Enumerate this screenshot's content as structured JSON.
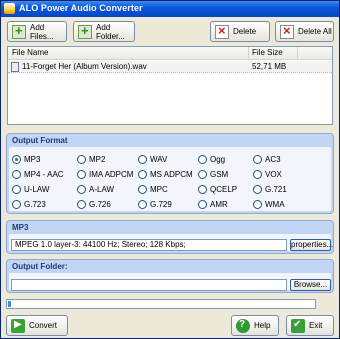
{
  "window": {
    "title": "ALO Power Audio Converter"
  },
  "toolbar": {
    "add_files": "Add Files...",
    "add_folder": "Add Folder...",
    "delete": "Delete",
    "delete_all": "Delete All"
  },
  "filelist": {
    "columns": [
      "File Name",
      "File Size"
    ],
    "rows": [
      {
        "name": "11-Forget Her (Album Version).wav",
        "size": "52,71 MB"
      }
    ]
  },
  "output_format": {
    "title": "Output Format",
    "selected": "MP3",
    "options": [
      "MP3",
      "MP2",
      "WAV",
      "Ogg",
      "AC3",
      "MP4 - AAC",
      "IMA ADPCM",
      "MS ADPCM",
      "GSM",
      "VOX",
      "U-LAW",
      "A-LAW",
      "MPC",
      "QCELP",
      "G.721",
      "G.723",
      "G.726",
      "G.729",
      "AMR",
      "WMA"
    ]
  },
  "settings": {
    "title": "MP3",
    "value": "MPEG 1.0 layer-3: 44100 Hz; Stereo;  128 Kbps;",
    "properties": "properties..."
  },
  "output_folder": {
    "title": "Output Folder:",
    "value": "",
    "browse": "Browse..."
  },
  "progress": {
    "fraction": 0.01
  },
  "bottom": {
    "convert": "Convert",
    "help": "Help",
    "exit": "Exit"
  }
}
